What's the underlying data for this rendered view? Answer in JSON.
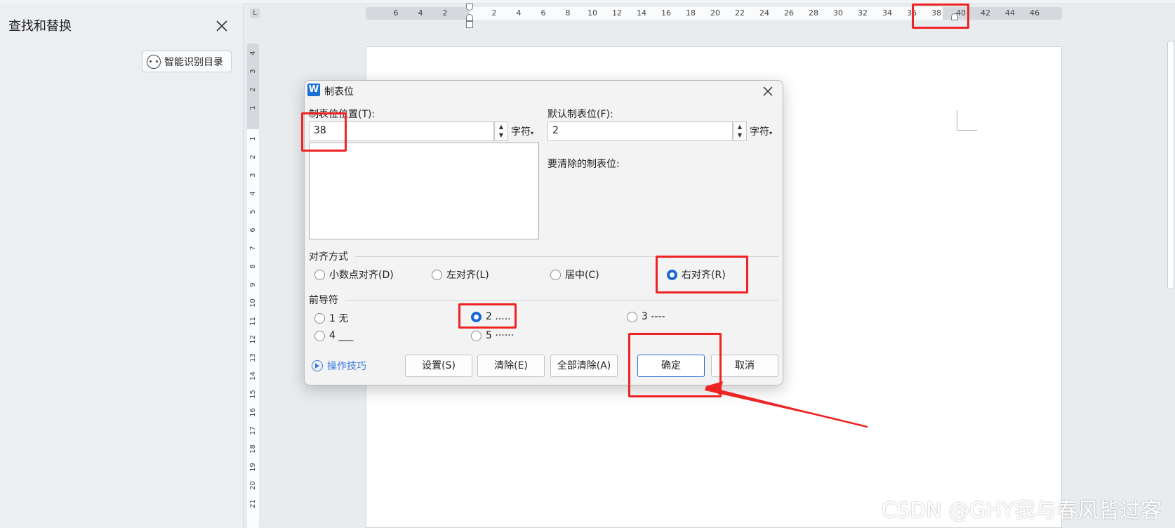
{
  "left_panel": {
    "title": "查找和替换",
    "smart_button_label": "智能识别目录"
  },
  "ruler": {
    "corner_glyph": "L",
    "h_ticks": [
      "6",
      "4",
      "2",
      "2",
      "4",
      "6",
      "8",
      "10",
      "12",
      "14",
      "16",
      "18",
      "20",
      "22",
      "24",
      "26",
      "28",
      "30",
      "32",
      "34",
      "36",
      "38",
      "40",
      "42",
      "44",
      "46"
    ],
    "v_ticks_top": [
      "4",
      "3",
      "2",
      "1"
    ],
    "v_ticks": [
      "1",
      "2",
      "3",
      "4",
      "5",
      "6",
      "7",
      "8",
      "9",
      "10",
      "11",
      "12",
      "13",
      "14",
      "15",
      "16",
      "17",
      "18",
      "19",
      "20",
      "21"
    ]
  },
  "dialog": {
    "title": "制表位",
    "logo_letter": "W",
    "tab_position_label": "制表位位置(T):",
    "tab_position_value": "38",
    "default_tab_label": "默认制表位(F):",
    "default_tab_value": "2",
    "unit_label": "字符",
    "clear_tabs_label": "要清除的制表位:",
    "alignment_group": "对齐方式",
    "alignment_options": [
      {
        "label": "小数点对齐(D)",
        "selected": false
      },
      {
        "label": "左对齐(L)",
        "selected": false
      },
      {
        "label": "居中(C)",
        "selected": false
      },
      {
        "label": "右对齐(R)",
        "selected": true
      }
    ],
    "leader_group": "前导符",
    "leader_options": [
      {
        "label": "1 无",
        "selected": false
      },
      {
        "label": "2 .....",
        "selected": true
      },
      {
        "label": "3 ----",
        "selected": false
      },
      {
        "label": "4 ___",
        "selected": false
      },
      {
        "label": "5 ······",
        "selected": false
      }
    ],
    "tips_label": "操作技巧",
    "buttons": {
      "set": "设置(S)",
      "clear": "清除(E)",
      "clear_all": "全部清除(A)",
      "ok": "确定",
      "cancel": "取消"
    }
  },
  "watermark": "CSDN @GHY我与春风皆过客",
  "colors": {
    "accent": "#1a66d2",
    "annotation_red": "#ee2323",
    "link_blue": "#3b7be0"
  }
}
